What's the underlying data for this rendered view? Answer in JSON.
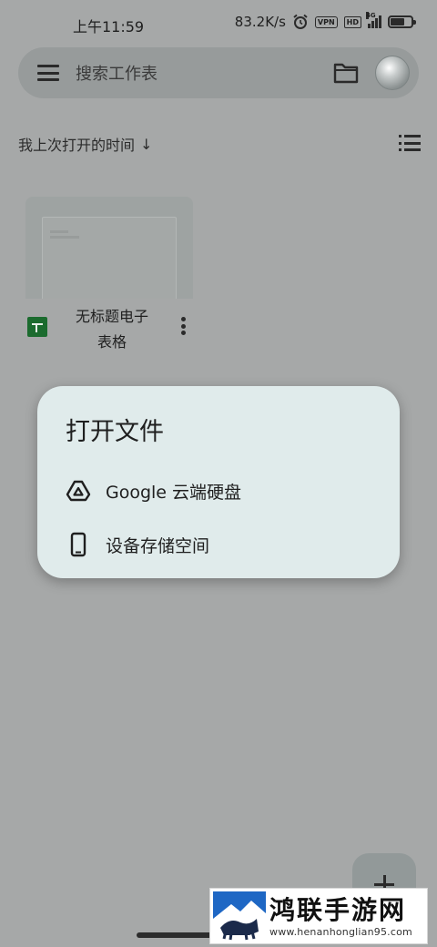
{
  "status_bar": {
    "time": "上午11:59",
    "network_speed": "83.2K/s",
    "alarm_icon": "alarm-icon",
    "vpn_badge": "VPN",
    "hd_badge": "HD",
    "signal_label": "4G",
    "battery_level": 0.7
  },
  "search": {
    "placeholder": "搜索工作表",
    "menu_icon": "hamburger-menu-icon",
    "folder_icon": "folder-icon"
  },
  "sort": {
    "label": "我上次打开的时间",
    "arrow": "↓"
  },
  "files": [
    {
      "name": "无标题电子表格",
      "type_icon": "google-sheets-icon"
    }
  ],
  "dialog": {
    "title": "打开文件",
    "options": [
      {
        "label": "Google 云端硬盘",
        "icon": "google-drive-icon"
      },
      {
        "label": "设备存储空间",
        "icon": "phone-icon"
      }
    ]
  },
  "fab": {
    "icon": "plus-icon"
  },
  "watermark": {
    "title": "鸿联手游网",
    "url": "www.henanhonglian95.com"
  },
  "colors": {
    "scrim_bg": "#a6a8a8",
    "dialog_bg": "#e0ebeb",
    "sheets_green": "#1b6b2e"
  }
}
